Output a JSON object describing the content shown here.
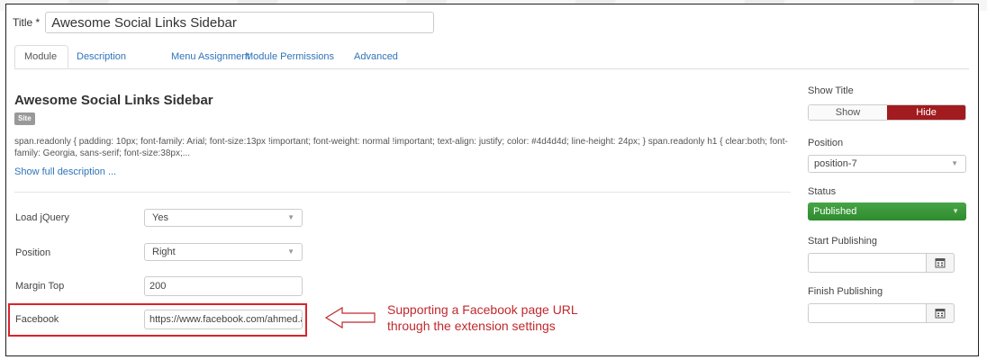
{
  "title_field": {
    "label": "Title *",
    "value": "Awesome Social Links Sidebar"
  },
  "tabs": [
    {
      "label": "Module"
    },
    {
      "label": "Description"
    },
    {
      "label": "Menu Assignment"
    },
    {
      "label": "Module Permissions"
    },
    {
      "label": "Advanced"
    }
  ],
  "module": {
    "heading": "Awesome Social Links Sidebar",
    "badge": "Site",
    "description": "span.readonly { padding: 10px; font-family: Arial; font-size:13px !important; font-weight: normal !important; text-align: justify; color: #4d4d4d; line-height: 24px; } span.readonly h1 { clear:both; font-family: Georgia, sans-serif; font-size:38px;...",
    "show_full": "Show full description ..."
  },
  "fields": {
    "load_jquery": {
      "label": "Load jQuery",
      "value": "Yes"
    },
    "position": {
      "label": "Position",
      "value": "Right"
    },
    "margin_top": {
      "label": "Margin Top",
      "value": "200"
    },
    "facebook": {
      "label": "Facebook",
      "value": "https://www.facebook.com/ahmed.a"
    }
  },
  "annotation": {
    "line1": "Supporting a Facebook page URL",
    "line2": "through the extension settings",
    "color": "#c0282e"
  },
  "sidebar": {
    "show_title": {
      "label": "Show Title",
      "show": "Show",
      "hide": "Hide"
    },
    "position": {
      "label": "Position",
      "value": "position-7"
    },
    "status": {
      "label": "Status",
      "value": "Published",
      "color": "#3a9a3a"
    },
    "start_publishing": {
      "label": "Start Publishing",
      "value": ""
    },
    "finish_publishing": {
      "label": "Finish Publishing",
      "value": ""
    }
  },
  "colors": {
    "link": "#2f74b8",
    "hide_active": "#a11b1f",
    "highlight": "#d9242b"
  }
}
